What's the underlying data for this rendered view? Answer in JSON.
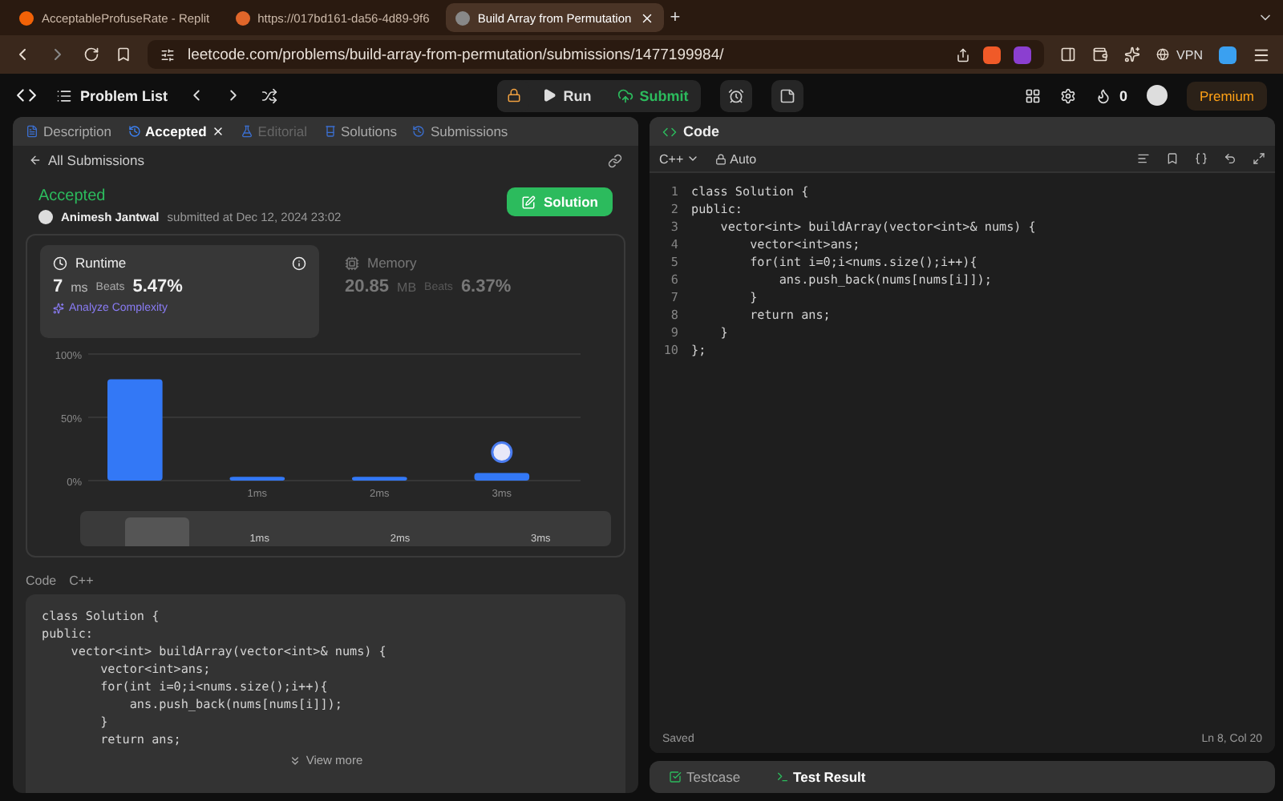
{
  "browser": {
    "tabs": [
      {
        "title": "AcceptableProfuseRate - Replit",
        "selected": false
      },
      {
        "title": "https://017bd161-da56-4d89-9f6",
        "selected": false
      },
      {
        "title": "Build Array from Permutation",
        "selected": true
      }
    ],
    "new_tab": "+",
    "address": "leetcode.com/problems/build-array-from-permutation/submissions/1477199984/",
    "vpn": "VPN"
  },
  "toolbar": {
    "problem_list": "Problem List",
    "run": "Run",
    "submit": "Submit",
    "streak": "0",
    "premium": "Premium"
  },
  "left_panel": {
    "tabs": [
      {
        "label": "Description",
        "selected": false,
        "disabled": false
      },
      {
        "label": "Accepted",
        "selected": true,
        "disabled": false
      },
      {
        "label": "Editorial",
        "selected": false,
        "disabled": true
      },
      {
        "label": "Solutions",
        "selected": false,
        "disabled": false
      },
      {
        "label": "Submissions",
        "selected": false,
        "disabled": false
      }
    ],
    "back_link": "All Submissions",
    "status": "Accepted",
    "author": "Animesh Jantwal",
    "submitted": "submitted at Dec 12, 2024 23:02",
    "solution_button": "Solution",
    "metrics": [
      {
        "title": "Runtime",
        "value": "7",
        "unit": "ms",
        "beats_label": "Beats",
        "beats": "5.47%",
        "selected": true
      },
      {
        "title": "Memory",
        "value": "20.85",
        "unit": "MB",
        "beats_label": "Beats",
        "beats": "6.37%",
        "selected": false
      }
    ],
    "analyze": "Analyze Complexity",
    "chart_data": {
      "type": "bar",
      "categories": [
        null,
        "1ms",
        "2ms",
        "3ms"
      ],
      "values": [
        80,
        3,
        3,
        6
      ],
      "ylim": [
        0,
        100
      ],
      "yticks": [
        {
          "value": 0,
          "label": "0%"
        },
        {
          "value": 50,
          "label": "50%"
        },
        {
          "value": 100,
          "label": "100%"
        }
      ]
    },
    "navigator_labels": [
      "1ms",
      "2ms",
      "3ms"
    ],
    "code_label": "Code",
    "code_language": "C++",
    "code_lines": [
      "class Solution {",
      "public:",
      "    vector<int> buildArray(vector<int>& nums) {",
      "        vector<int>ans;",
      "        for(int i=0;i<nums.size();i++){",
      "            ans.push_back(nums[nums[i]]);",
      "        }",
      "        return ans;"
    ],
    "view_more": "View more"
  },
  "right_panel": {
    "title": "Code",
    "language": "C++",
    "mode": "Auto",
    "lines": [
      {
        "number": "1",
        "text": "class Solution {"
      },
      {
        "number": "2",
        "text": "public:"
      },
      {
        "number": "3",
        "text": "    vector<int> buildArray(vector<int>& nums) {"
      },
      {
        "number": "4",
        "text": "        vector<int>ans;"
      },
      {
        "number": "5",
        "text": "        for(int i=0;i<nums.size();i++){"
      },
      {
        "number": "6",
        "text": "            ans.push_back(nums[nums[i]]);"
      },
      {
        "number": "7",
        "text": "        }"
      },
      {
        "number": "8",
        "text": "        return ans;"
      },
      {
        "number": "9",
        "text": "    }"
      },
      {
        "number": "10",
        "text": "};"
      }
    ],
    "status": "Saved",
    "cursor": "Ln 8, Col 20",
    "bottom_tabs": [
      {
        "label": "Testcase",
        "selected": false
      },
      {
        "label": "Test Result",
        "selected": true
      }
    ]
  }
}
